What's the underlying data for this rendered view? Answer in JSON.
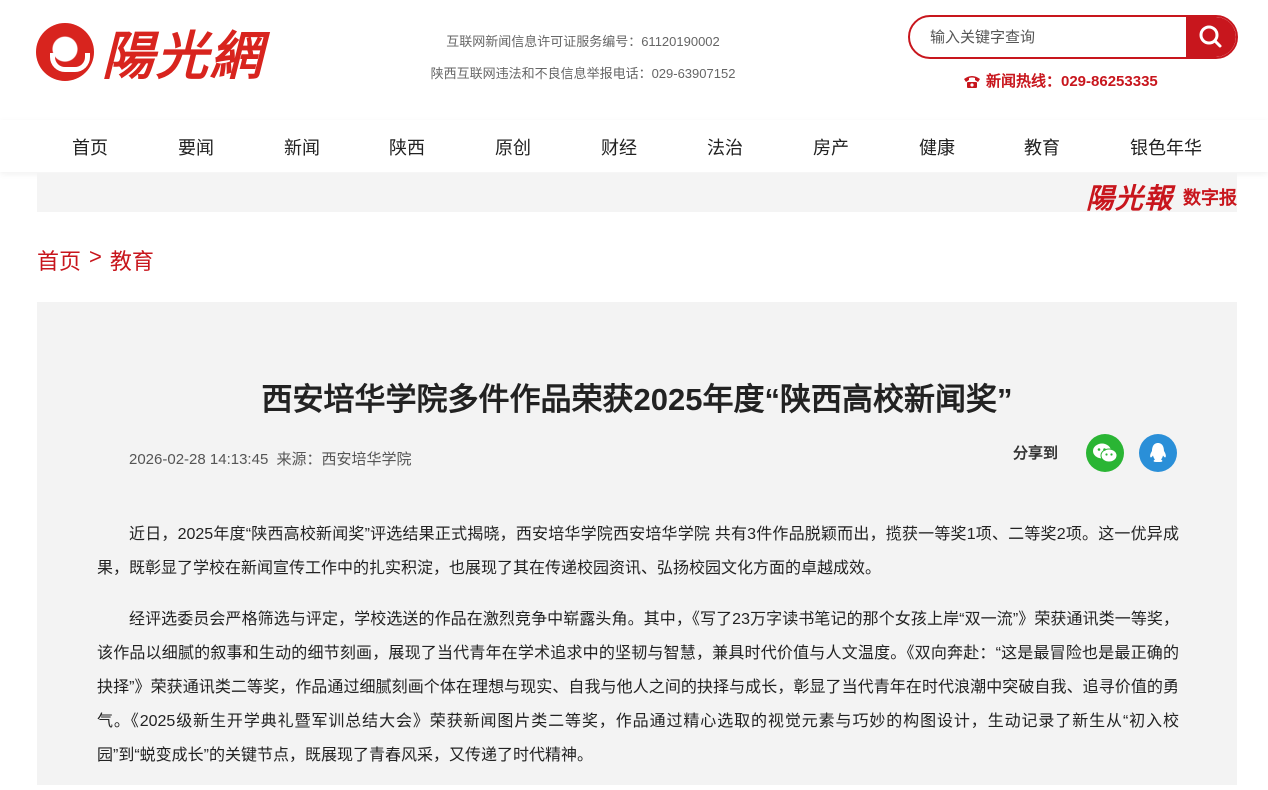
{
  "header": {
    "logo_text": "陽光網",
    "license_line1": "互联网新闻信息许可证服务编号：61120190002",
    "license_line2": "陕西互联网违法和不良信息举报电话：029-63907152",
    "search_placeholder": "输入关键字查询",
    "hotline": "新闻热线：029-86253335"
  },
  "nav": {
    "items": [
      "首页",
      "要闻",
      "新闻",
      "陕西",
      "原创",
      "财经",
      "法治",
      "房产",
      "健康",
      "教育",
      "银色年华"
    ]
  },
  "digital": {
    "brand": "陽光報",
    "label": "数字报"
  },
  "breadcrumb": {
    "home": "首页",
    "sep": ">",
    "current": "教育"
  },
  "article": {
    "title": "西安培华学院多件作品荣获2025年度“陕西高校新闻奖”",
    "datetime": "2026-02-28 14:13:45",
    "source": "来源：西安培华学院",
    "share_label": "分享到",
    "paragraphs": [
      "近日，2025年度“陕西高校新闻奖”评选结果正式揭晓，西安培华学院西安培华学院 共有3件作品脱颖而出，揽获一等奖1项、二等奖2项。这一优异成果，既彰显了学校在新闻宣传工作中的扎实积淀，也展现了其在传递校园资讯、弘扬校园文化方面的卓越成效。",
      "经评选委员会严格筛选与评定，学校选送的作品在激烈竞争中崭露头角。其中，《写了23万字读书笔记的那个女孩上岸“双一流”》荣获通讯类一等奖，该作品以细腻的叙事和生动的细节刻画，展现了当代青年在学术追求中的坚韧与智慧，兼具时代价值与人文温度。《双向奔赴：“这是最冒险也是最正确的抉择”》荣获通讯类二等奖，作品通过细腻刻画个体在理想与现实、自我与他人之间的抉择与成长，彰显了当代青年在时代浪潮中突破自我、追寻价值的勇气。《2025级新生开学典礼暨军训总结大会》荣获新闻图片类二等奖，作品通过精心选取的视觉元素与巧妙的构图设计，生动记录了新生从“初入校园”到“蜕变成长”的关键节点，既展现了青春风采，又传递了时代精神。"
    ]
  },
  "colors": {
    "brand_red": "#c8161d",
    "wechat_green": "#2ab534",
    "qq_blue": "#2a8fd8"
  },
  "icons": [
    "search-icon",
    "phone-icon",
    "wechat-icon",
    "qq-icon"
  ]
}
